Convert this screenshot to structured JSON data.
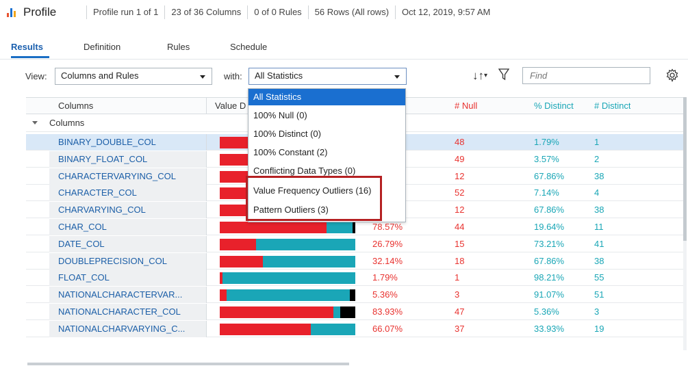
{
  "header": {
    "title": "Profile",
    "meta": [
      "Profile run 1 of 1",
      "23 of 36 Columns",
      "0 of 0 Rules",
      "56 Rows (All rows)",
      "Oct 12, 2019, 9:57 AM"
    ]
  },
  "tabs": [
    "Results",
    "Definition",
    "Rules",
    "Schedule"
  ],
  "toolbar": {
    "view_label": "View:",
    "view_value": "Columns and Rules",
    "with_label": "with:",
    "with_value": "All Statistics",
    "find_placeholder": "Find",
    "sort_icon": "sort-icon",
    "filter_icon": "filter-icon",
    "settings_icon": "gear-icon"
  },
  "dropdown": {
    "options": [
      "All Statistics",
      "100% Null (0)",
      "100% Distinct (0)",
      "100% Constant (2)",
      "Conflicting Data Types (0)",
      "Value Frequency Outliers (16)",
      "Pattern Outliers (3)"
    ],
    "selected": "All Statistics"
  },
  "table": {
    "headers": {
      "columns": "Columns",
      "value_dist": "Value D",
      "null_count": "# Null",
      "pct_distinct": "% Distinct",
      "distinct_count": "# Distinct"
    },
    "group": "Columns",
    "rows": [
      {
        "name": "BINARY_DOUBLE_COL",
        "pct": "%",
        "null": "48",
        "pct_distinct": "1.79%",
        "distinct": "1",
        "bar": [
          0.27,
          0.73,
          0
        ]
      },
      {
        "name": "BINARY_FLOAT_COL",
        "pct": "",
        "null": "49",
        "pct_distinct": "3.57%",
        "distinct": "2",
        "bar": [
          0.27,
          0.73,
          0
        ]
      },
      {
        "name": "CHARACTERVARYING_COL",
        "pct": "%",
        "null": "12",
        "pct_distinct": "67.86%",
        "distinct": "38",
        "bar": [
          0.27,
          0.73,
          0
        ]
      },
      {
        "name": "CHARACTER_COL",
        "pct": "%",
        "null": "52",
        "pct_distinct": "7.14%",
        "distinct": "4",
        "bar": [
          0.27,
          0.73,
          0
        ]
      },
      {
        "name": "CHARVARYING_COL",
        "pct": "21.43%",
        "null": "12",
        "pct_distinct": "67.86%",
        "distinct": "38",
        "bar": [
          0.21,
          0.68,
          0.11
        ]
      },
      {
        "name": "CHAR_COL",
        "pct": "78.57%",
        "null": "44",
        "pct_distinct": "19.64%",
        "distinct": "11",
        "bar": [
          0.79,
          0.19,
          0.02
        ]
      },
      {
        "name": "DATE_COL",
        "pct": "26.79%",
        "null": "15",
        "pct_distinct": "73.21%",
        "distinct": "41",
        "bar": [
          0.27,
          0.73,
          0
        ]
      },
      {
        "name": "DOUBLEPRECISION_COL",
        "pct": "32.14%",
        "null": "18",
        "pct_distinct": "67.86%",
        "distinct": "38",
        "bar": [
          0.32,
          0.68,
          0
        ]
      },
      {
        "name": "FLOAT_COL",
        "pct": "1.79%",
        "null": "1",
        "pct_distinct": "98.21%",
        "distinct": "55",
        "bar": [
          0.02,
          0.98,
          0
        ]
      },
      {
        "name": "NATIONALCHARACTERVAR...",
        "pct": "5.36%",
        "null": "3",
        "pct_distinct": "91.07%",
        "distinct": "51",
        "bar": [
          0.05,
          0.91,
          0.04
        ]
      },
      {
        "name": "NATIONALCHARACTER_COL",
        "pct": "83.93%",
        "null": "47",
        "pct_distinct": "5.36%",
        "distinct": "3",
        "bar": [
          0.84,
          0.05,
          0.11
        ]
      },
      {
        "name": "NATIONALCHARVARYING_C...",
        "pct": "66.07%",
        "null": "37",
        "pct_distinct": "33.93%",
        "distinct": "19",
        "bar": [
          0.67,
          0.33,
          0
        ]
      }
    ]
  },
  "colors": {
    "null": "#e8212b",
    "distinct": "#1aa6b7",
    "constant": "#000000",
    "accent": "#1a6fd0",
    "highlight": "#b52022"
  }
}
